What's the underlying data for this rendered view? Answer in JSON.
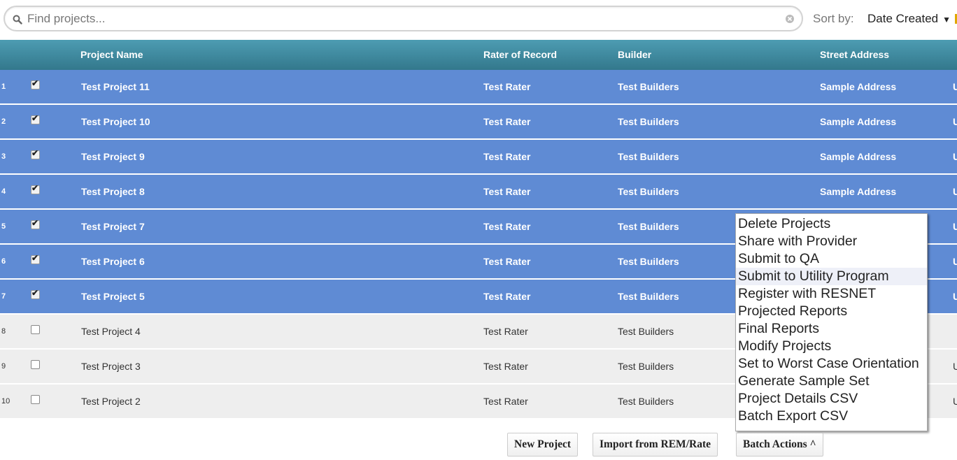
{
  "search": {
    "placeholder": "Find projects..."
  },
  "sort": {
    "label": "Sort by:",
    "value": "Date Created"
  },
  "columns": [
    "Project Name",
    "Rater of Record",
    "Builder",
    "Street Address"
  ],
  "rows": [
    {
      "num": "1",
      "name": "Test Project 11",
      "rater": "Test Rater",
      "builder": "Test Builders",
      "address": "Sample Address",
      "more": "U",
      "selected": true
    },
    {
      "num": "2",
      "name": "Test Project 10",
      "rater": "Test Rater",
      "builder": "Test Builders",
      "address": "Sample Address",
      "more": "U",
      "selected": true
    },
    {
      "num": "3",
      "name": "Test Project 9",
      "rater": "Test Rater",
      "builder": "Test Builders",
      "address": "Sample Address",
      "more": "U",
      "selected": true
    },
    {
      "num": "4",
      "name": "Test Project 8",
      "rater": "Test Rater",
      "builder": "Test Builders",
      "address": "Sample Address",
      "more": "U",
      "selected": true
    },
    {
      "num": "5",
      "name": "Test Project 7",
      "rater": "Test Rater",
      "builder": "Test Builders",
      "address": "",
      "more": "U",
      "selected": true
    },
    {
      "num": "6",
      "name": "Test Project 6",
      "rater": "Test Rater",
      "builder": "Test Builders",
      "address": "",
      "more": "U",
      "selected": true
    },
    {
      "num": "7",
      "name": "Test Project 5",
      "rater": "Test Rater",
      "builder": "Test Builders",
      "address": "",
      "more": "U",
      "selected": true
    },
    {
      "num": "8",
      "name": "Test Project 4",
      "rater": "Test Rater",
      "builder": "Test Builders",
      "address": "",
      "more": "",
      "selected": false
    },
    {
      "num": "9",
      "name": "Test Project 3",
      "rater": "Test Rater",
      "builder": "Test Builders",
      "address": "",
      "more": "U",
      "selected": false
    },
    {
      "num": "10",
      "name": "Test Project 2",
      "rater": "Test Rater",
      "builder": "Test Builders",
      "address": "",
      "more": "U",
      "selected": false
    }
  ],
  "batch_menu": {
    "items": [
      "Delete Projects",
      "Share with Provider",
      "Submit to QA",
      "Submit to Utility Program",
      "Register with RESNET",
      "Projected Reports",
      "Final Reports",
      "Modify Projects",
      "Set to Worst Case Orientation",
      "Generate Sample Set",
      "Project Details CSV",
      "Batch Export CSV"
    ],
    "highlighted": "Submit to Utility Program"
  },
  "buttons": {
    "new_project": "New Project",
    "import": "Import from REM/Rate",
    "batch_actions": "Batch Actions ^"
  },
  "icons": {
    "search": "search-icon",
    "clear": "clear-icon",
    "sort_caret": "caret-down-icon",
    "checkbox": "check-icon"
  },
  "colors": {
    "selected_row": "#5f8bd4",
    "header": "#3f8aa0",
    "unselected_row": "#eeeeee"
  }
}
